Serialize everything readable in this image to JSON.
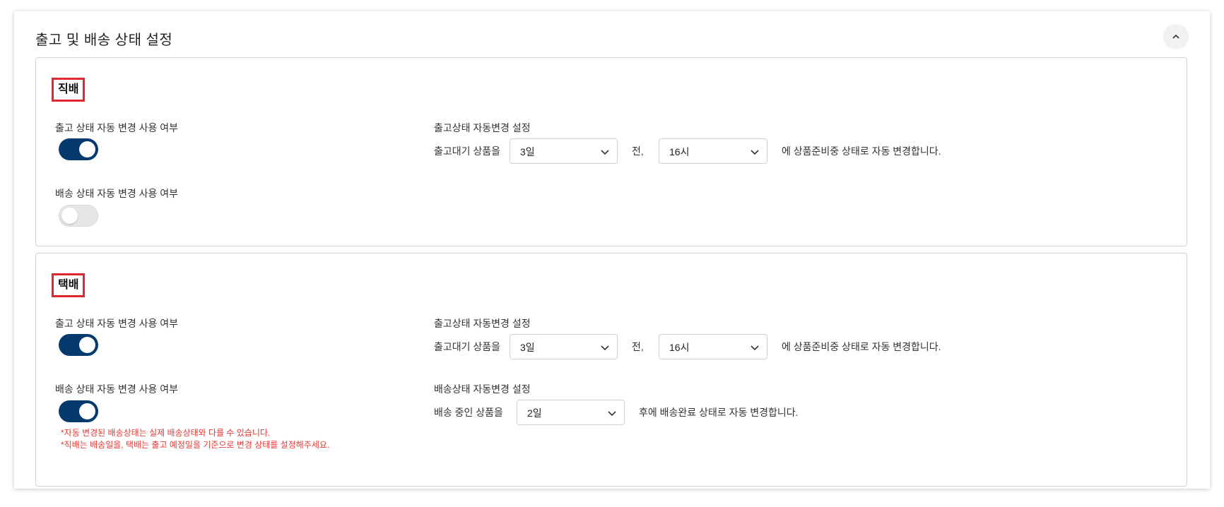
{
  "header": {
    "title": "출고 및 배송 상태 설정",
    "collapse_icon": "chevron-up-icon"
  },
  "direct": {
    "tag": "직배",
    "release_toggle_label": "출고 상태 자동 변경 사용 여부",
    "release_toggle_on": true,
    "delivery_toggle_label": "배송 상태 자동 변경 사용 여부",
    "delivery_toggle_on": false,
    "release_setting_title": "출고상태 자동변경 설정",
    "release_prefix": "출고대기 상품을",
    "release_days": "3일",
    "release_mid": "전,",
    "release_hour": "16시",
    "release_suffix": "에 상품준비중 상태로 자동 변경합니다."
  },
  "courier": {
    "tag": "택배",
    "release_toggle_label": "출고 상태 자동 변경 사용 여부",
    "release_toggle_on": true,
    "delivery_toggle_label": "배송 상태 자동 변경 사용 여부",
    "delivery_toggle_on": true,
    "release_setting_title": "출고상태 자동변경 설정",
    "release_prefix": "출고대기 상품을",
    "release_days": "3일",
    "release_mid": "전,",
    "release_hour": "16시",
    "release_suffix": "에 상품준비중 상태로 자동 변경합니다.",
    "delivery_setting_title": "배송상태 자동변경 설정",
    "delivery_prefix": "배송 중인 상품을",
    "delivery_days": "2일",
    "delivery_suffix": "후에 배송완료 상태로 자동 변경합니다.",
    "notice_1": "*자동 변경된 배송상태는 실제 배송상태와 다를 수 있습니다.",
    "notice_2": "*직배는 배송일을, 택배는 출고 예정일을 기준으로 변경 상태를 설정해주세요."
  },
  "colors": {
    "toggle_on": "#053a6e",
    "toggle_off": "#e6e6e6",
    "tag_border": "#e0282e",
    "notice_text": "#e53935"
  }
}
